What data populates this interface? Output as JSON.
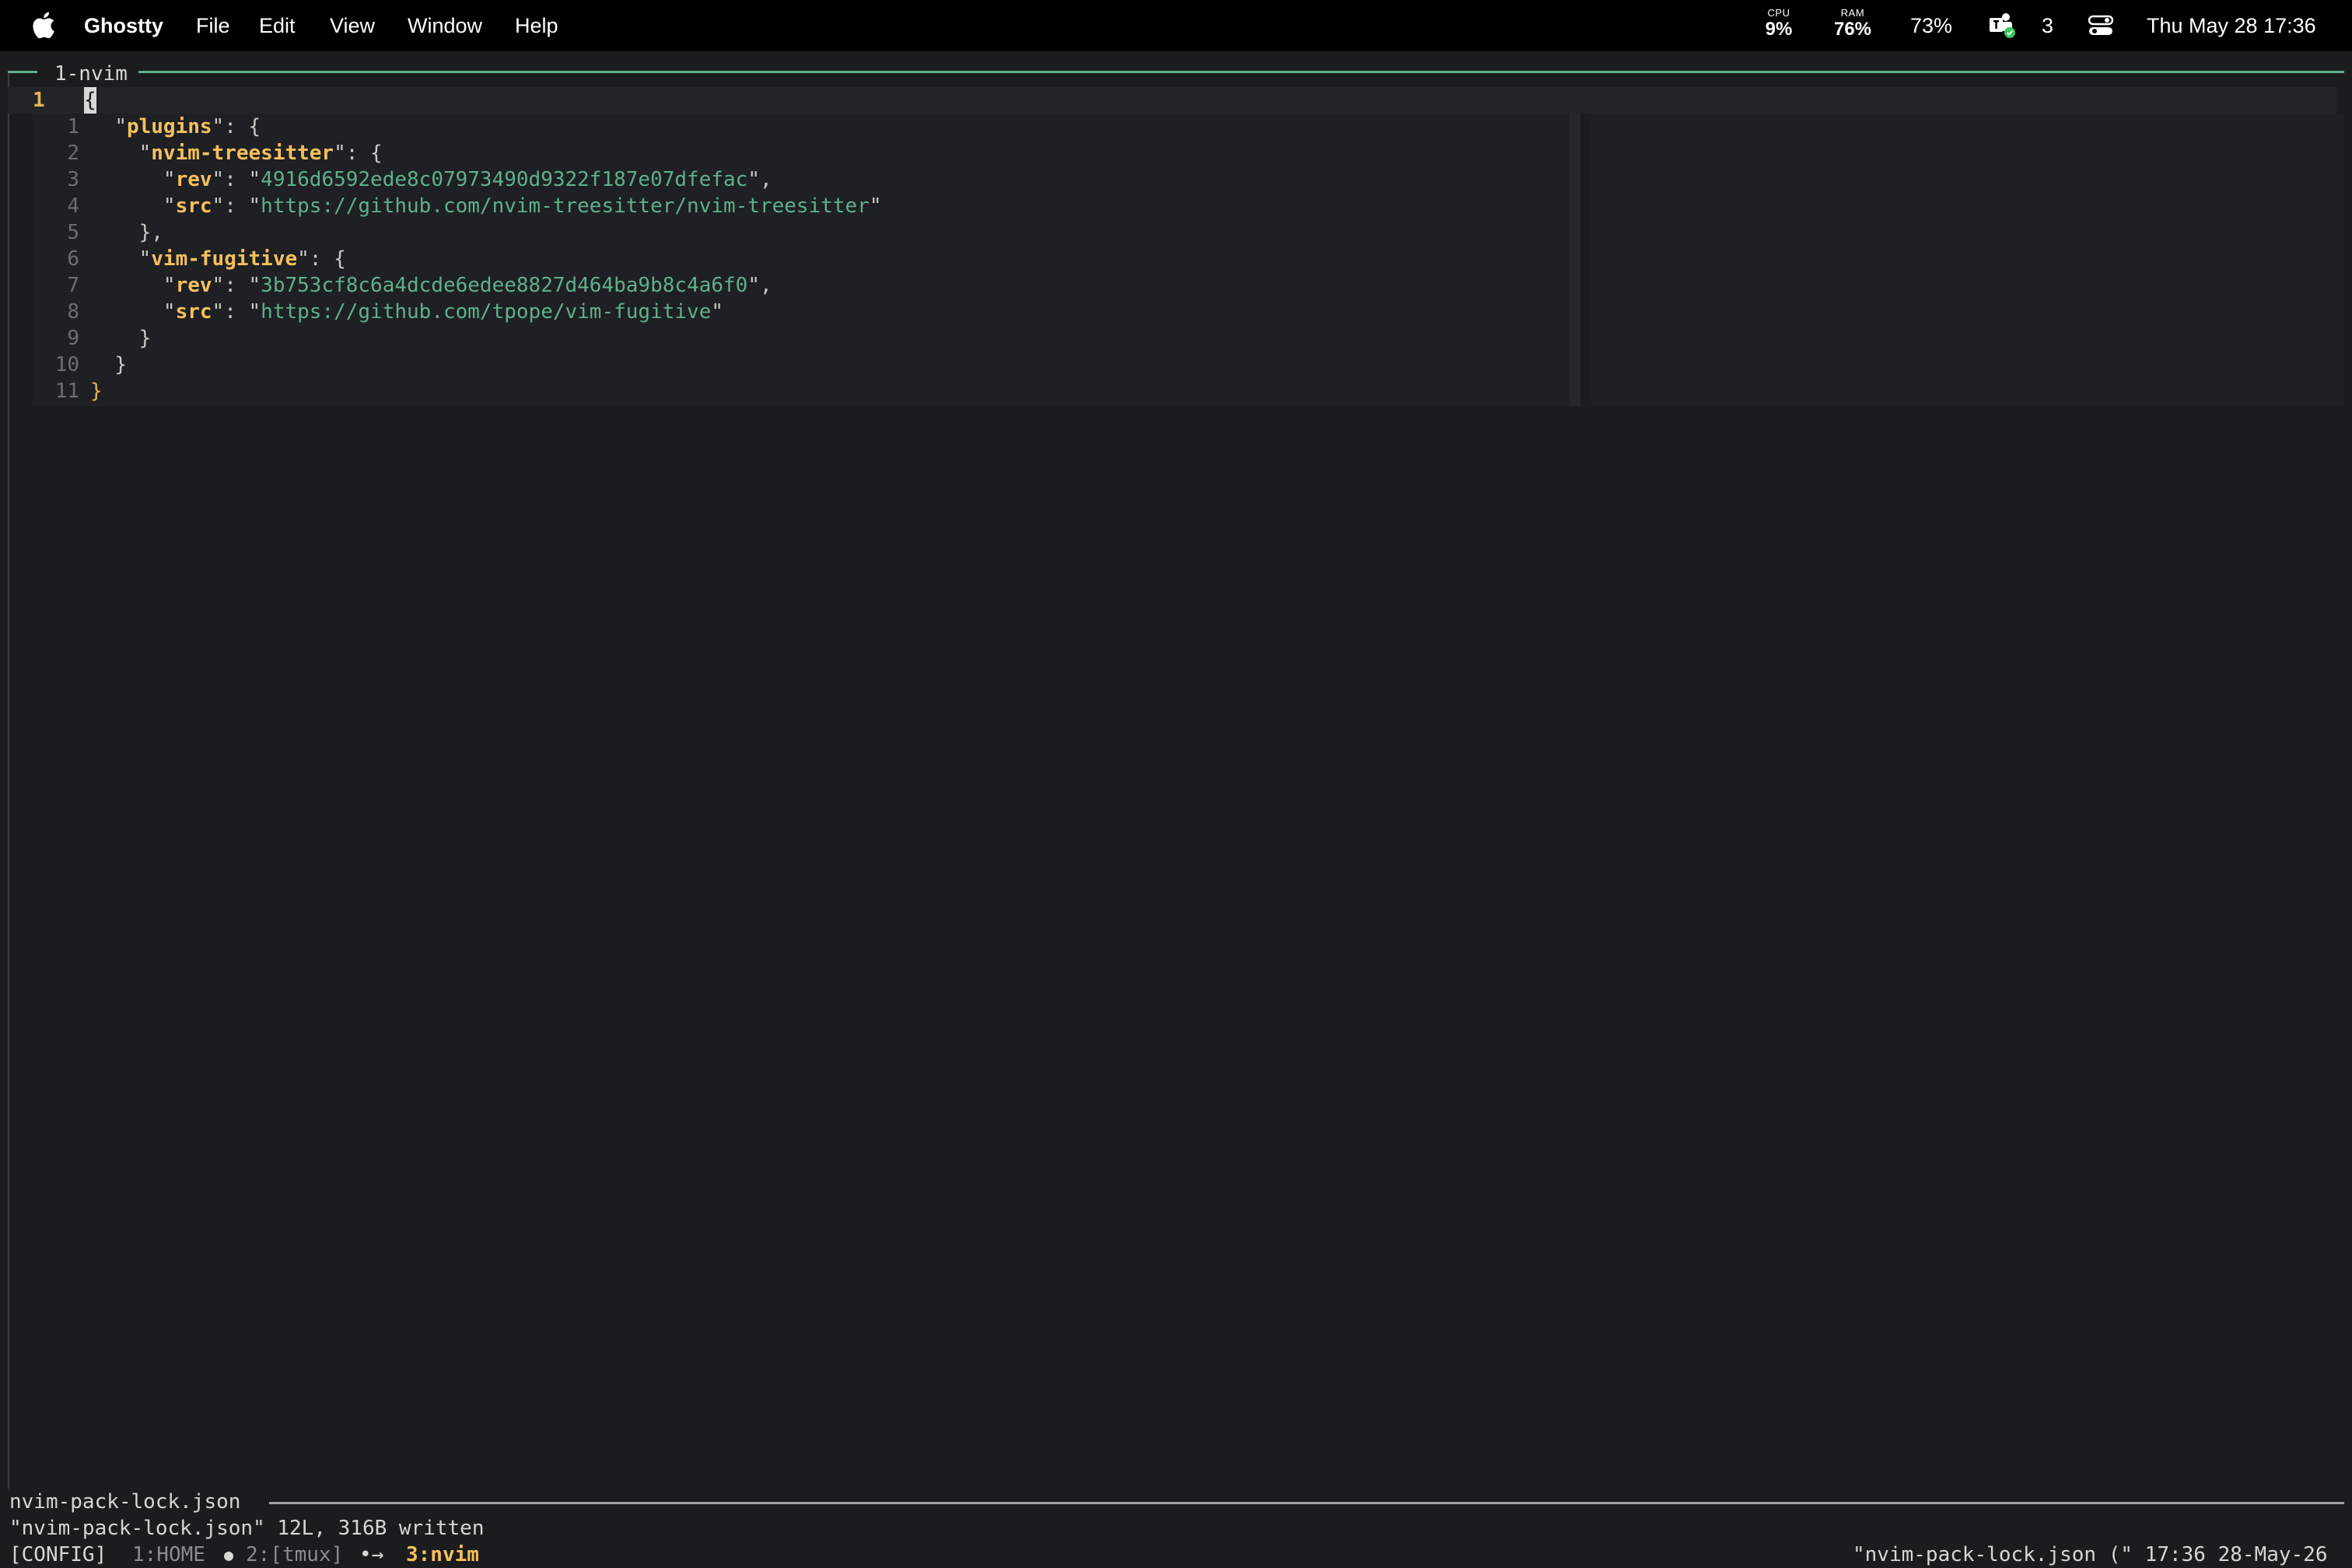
{
  "menubar": {
    "app_name": "Ghostty",
    "menus": [
      "File",
      "Edit",
      "View",
      "Window",
      "Help"
    ],
    "cpu": {
      "label": "CPU",
      "value": "9%"
    },
    "ram": {
      "label": "RAM",
      "value": "76%"
    },
    "battery": "73%",
    "teams_count": "3",
    "clock": "Thu May 28  17:36",
    "icons": [
      "apple-logo-icon",
      "teams-icon",
      "control-center-icon"
    ]
  },
  "pane": {
    "title": "1-nvim"
  },
  "editor": {
    "cursor_line_number": "1",
    "cursor_char": "{",
    "preview_lines": [
      {
        "n": "1",
        "indent": "  ",
        "parts": [
          [
            "p",
            "\""
          ],
          [
            "k",
            "plugins"
          ],
          [
            "p",
            "\": {"
          ]
        ]
      },
      {
        "n": "2",
        "indent": "    ",
        "parts": [
          [
            "p",
            "\""
          ],
          [
            "k",
            "nvim-treesitter"
          ],
          [
            "p",
            "\": {"
          ]
        ]
      },
      {
        "n": "3",
        "indent": "      ",
        "parts": [
          [
            "p",
            "\""
          ],
          [
            "k",
            "rev"
          ],
          [
            "p",
            "\": \""
          ],
          [
            "s",
            "4916d6592ede8c07973490d9322f187e07dfefac"
          ],
          [
            "p",
            "\","
          ]
        ]
      },
      {
        "n": "4",
        "indent": "      ",
        "parts": [
          [
            "p",
            "\""
          ],
          [
            "k",
            "src"
          ],
          [
            "p",
            "\": \""
          ],
          [
            "s",
            "https://github.com/nvim-treesitter/nvim-treesitter"
          ],
          [
            "p",
            "\""
          ]
        ]
      },
      {
        "n": "5",
        "indent": "    ",
        "parts": [
          [
            "p",
            "},"
          ]
        ]
      },
      {
        "n": "6",
        "indent": "    ",
        "parts": [
          [
            "p",
            "\""
          ],
          [
            "k",
            "vim-fugitive"
          ],
          [
            "p",
            "\": {"
          ]
        ]
      },
      {
        "n": "7",
        "indent": "      ",
        "parts": [
          [
            "p",
            "\""
          ],
          [
            "k",
            "rev"
          ],
          [
            "p",
            "\": \""
          ],
          [
            "s",
            "3b753cf8c6a4dcde6edee8827d464ba9b8c4a6f0"
          ],
          [
            "p",
            "\","
          ]
        ]
      },
      {
        "n": "8",
        "indent": "      ",
        "parts": [
          [
            "p",
            "\""
          ],
          [
            "k",
            "src"
          ],
          [
            "p",
            "\": \""
          ],
          [
            "s",
            "https://github.com/tpope/vim-fugitive"
          ],
          [
            "p",
            "\""
          ]
        ]
      },
      {
        "n": "9",
        "indent": "    ",
        "parts": [
          [
            "p",
            "}"
          ]
        ]
      },
      {
        "n": "10",
        "indent": "  ",
        "parts": [
          [
            "p",
            "}"
          ]
        ]
      },
      {
        "n": "11",
        "indent": "",
        "parts": [
          [
            "lb",
            "}"
          ]
        ]
      }
    ]
  },
  "statusline": {
    "filename": "nvim-pack-lock.json"
  },
  "message": "\"nvim-pack-lock.json\" 12L, 316B written",
  "tmux": {
    "session": "[CONFIG]",
    "win1": "1:HOME",
    "bullet1": "●",
    "win2": "2:[tmux]",
    "arrow": "•→",
    "win3": "3:nvim",
    "right": "\"nvim-pack-lock.json (\" 17:36 28-May-26"
  }
}
